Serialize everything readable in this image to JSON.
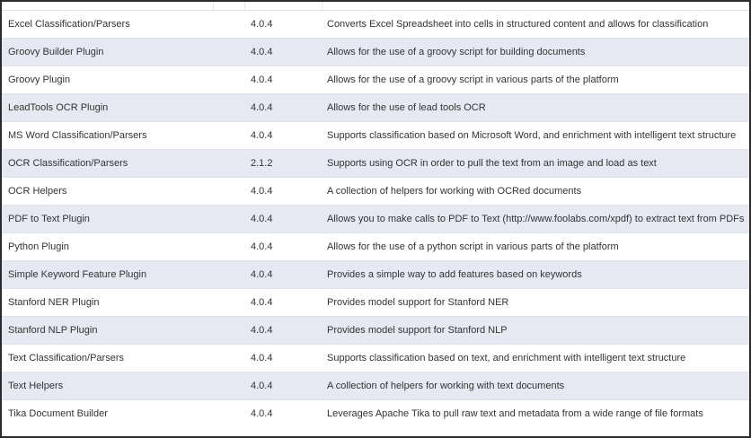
{
  "table": {
    "rows": [
      {
        "name": "Excel Classification/Parsers",
        "version": "4.0.4",
        "description": "Converts Excel Spreadsheet into cells in structured content and allows for classification"
      },
      {
        "name": "Groovy Builder Plugin",
        "version": "4.0.4",
        "description": "Allows for the use of a groovy script for building documents"
      },
      {
        "name": "Groovy Plugin",
        "version": "4.0.4",
        "description": "Allows for the use of a groovy script in various parts of the platform"
      },
      {
        "name": "LeadTools OCR Plugin",
        "version": "4.0.4",
        "description": "Allows for the use of lead tools OCR"
      },
      {
        "name": "MS Word Classification/Parsers",
        "version": "4.0.4",
        "description": "Supports classification based on Microsoft Word, and enrichment with intelligent text structure"
      },
      {
        "name": "OCR Classification/Parsers",
        "version": "2.1.2",
        "description": "Supports using OCR in order to pull the text from an image and load as text"
      },
      {
        "name": "OCR Helpers",
        "version": "4.0.4",
        "description": "A collection of helpers for working with OCRed documents"
      },
      {
        "name": "PDF to Text Plugin",
        "version": "4.0.4",
        "description": "Allows you to make calls to PDF to Text (http://www.foolabs.com/xpdf) to extract text from PDFs"
      },
      {
        "name": "Python Plugin",
        "version": "4.0.4",
        "description": "Allows for the use of a python script in various parts of the platform"
      },
      {
        "name": "Simple Keyword Feature Plugin",
        "version": "4.0.4",
        "description": "Provides a simple way to add features based on keywords"
      },
      {
        "name": "Stanford NER Plugin",
        "version": "4.0.4",
        "description": "Provides model support for Stanford NER"
      },
      {
        "name": "Stanford NLP Plugin",
        "version": "4.0.4",
        "description": "Provides model support for Stanford NLP"
      },
      {
        "name": "Text Classification/Parsers",
        "version": "4.0.4",
        "description": "Supports classification based on text, and enrichment with intelligent text structure"
      },
      {
        "name": "Text Helpers",
        "version": "4.0.4",
        "description": "A collection of helpers for working with text documents"
      },
      {
        "name": "Tika Document Builder",
        "version": "4.0.4",
        "description": "Leverages Apache Tika to pull raw text and metadata from a wide range of file formats"
      }
    ]
  }
}
